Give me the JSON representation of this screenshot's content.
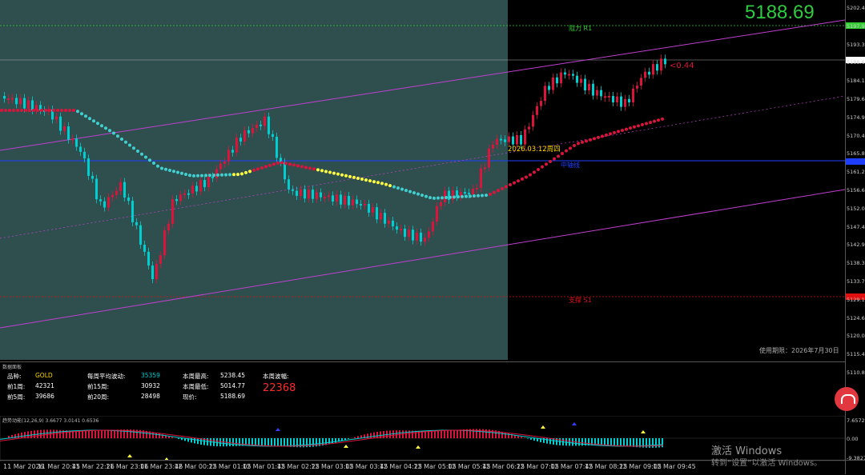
{
  "main": {
    "price_big": "5188.69",
    "price_delta": "<0.44",
    "date_label": "2026.03.12周四",
    "label_top": "阻力 R1",
    "label_mid": "中轴线",
    "label_bottom": "支撑 S1",
    "expiry": "使用期限：2026年7月30日",
    "price_scale": [
      "5202.45",
      "5197.91",
      "5193.35",
      "5188.69",
      "5184.10",
      "5179.60",
      "5174.90",
      "5170.40",
      "5165.80",
      "5161.20",
      "5156.60",
      "5152.00",
      "5147.40",
      "5142.90",
      "5138.30",
      "5133.70",
      "5129.10",
      "5124.60",
      "5120.00",
      "5115.40",
      "5110.80"
    ],
    "colors": {
      "bg_left": "#2f4f4f",
      "bg_right": "#000000",
      "bull": "#dc143c",
      "bear": "#00ced1",
      "channel": "#c040d0",
      "resist": "#32cd32",
      "support": "#e01010",
      "midline": "#1f3fff"
    }
  },
  "info_panel": {
    "title": "数据面板",
    "rows": [
      [
        {
          "k": "品种:",
          "v": "GOLD"
        },
        {
          "k": "每周平均波动:",
          "v": "35359"
        },
        {
          "k": "本周最高:",
          "v": "5238.45"
        },
        {
          "k": "本周波幅:",
          "v": ""
        }
      ],
      [
        {
          "k": "前1周:",
          "v": "42321"
        },
        {
          "k": "前15周:",
          "v": "30932"
        },
        {
          "k": "本周最低:",
          "v": "5014.77"
        },
        {
          "k": "",
          "v": ""
        }
      ],
      [
        {
          "k": "前5周:",
          "v": "39686"
        },
        {
          "k": "前20周:",
          "v": "28498"
        },
        {
          "k": "现价:",
          "v": "5188.69"
        },
        {
          "k": "",
          "v": ""
        }
      ]
    ],
    "weekly_range": "22368"
  },
  "macd_panel": {
    "title": "趋势动能(12,26,9) 3.6677 3.0141 0.6536",
    "scale": [
      "7.6572",
      "0.00",
      "-9.3827"
    ]
  },
  "time_axis": [
    "11 Mar 2026",
    "11 Mar 20:45",
    "11 Mar 22:26",
    "11 Mar 23:06",
    "11 Mar 23:46",
    "12 Mar 00:25",
    "12 Mar 01:05",
    "12 Mar 01:45",
    "12 Mar 02:25",
    "12 Mar 03:05",
    "12 Mar 03:45",
    "12 Mar 04:25",
    "12 Mar 05:05",
    "12 Mar 05:45",
    "12 Mar 06:25",
    "12 Mar 07:05",
    "12 Mar 07:45",
    "12 Mar 08:25",
    "12 Mar 09:05",
    "12 Mar 09:45"
  ],
  "watermark": {
    "title": "激活 Windows",
    "subtitle": "转到“设置”以激活 Windows。"
  }
}
